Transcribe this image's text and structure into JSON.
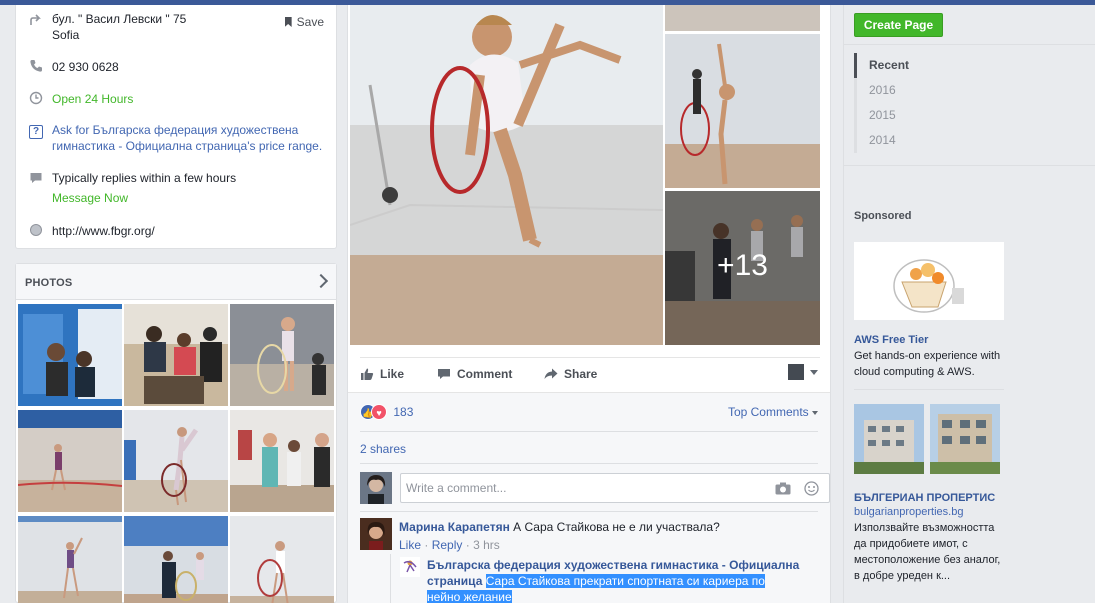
{
  "info": {
    "address_line1": "бул. \" Васил Левски \" 75",
    "address_line2": "Sofia",
    "save_label": "Save",
    "phone": "02 930 0628",
    "hours": "Open 24 Hours",
    "price_line1": "Ask for Българска федерация художествена",
    "price_line2": "гимнастика - Официална страница's price range.",
    "replies": "Typically replies within a few hours",
    "message_now": "Message Now",
    "website": "http://www.fbgr.org/"
  },
  "photos": {
    "title": "PHOTOS"
  },
  "post": {
    "more_photos": "+13",
    "actions": {
      "like": "Like",
      "comment": "Comment",
      "share": "Share"
    },
    "reaction_count": "183",
    "sort_label": "Top Comments",
    "shares": "2 shares",
    "comment_placeholder": "Write a comment...",
    "comments": [
      {
        "author": "Марина Карапетян",
        "text": "А Сара Стайкова не е ли участвала?",
        "like": "Like",
        "reply": "Reply",
        "dot": "·",
        "time": "3 hrs"
      }
    ],
    "reply": {
      "author_line1": "Българска федерация художествена гимнастика - Официална",
      "author_line2": "страница",
      "text_line1": "Сара Стайкова прекрати спортната си кариера по",
      "text_line2": "нейно желание"
    }
  },
  "right": {
    "create_page": "Create Page",
    "years": [
      "Recent",
      "2016",
      "2015",
      "2014"
    ],
    "sponsored": "Sponsored",
    "ad1": {
      "title": "AWS Free Tier",
      "text_line1": "Get hands-on experience with",
      "text_line2": "cloud computing & AWS."
    },
    "ad2": {
      "title": "БЪЛГЕРИАН ПРОПЕРТИС",
      "domain": "bulgarianproperties.bg",
      "text_lines": [
        "Използвайте възможността",
        "да придобиете имот, с",
        "местоположение без аналог,",
        "в добре уреден к..."
      ]
    }
  },
  "colors": {
    "brand": "#3b5998",
    "link": "#4267b2",
    "green": "#42b72a",
    "highlight": "#3390ff"
  }
}
